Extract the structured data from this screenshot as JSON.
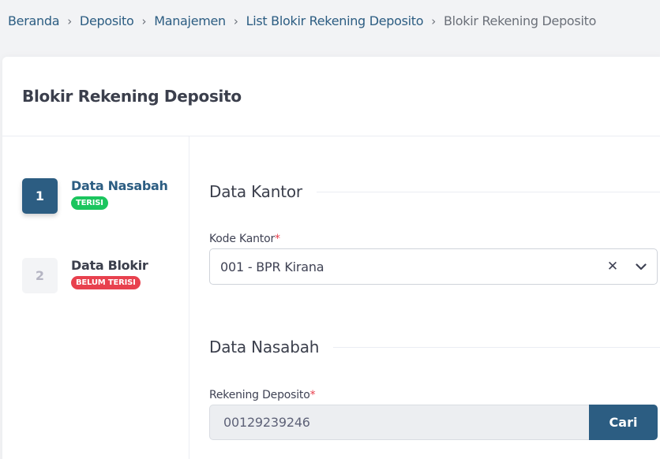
{
  "breadcrumb": {
    "items": [
      "Beranda",
      "Deposito",
      "Manajemen",
      "List Blokir Rekening Deposito"
    ],
    "current": "Blokir Rekening Deposito"
  },
  "card": {
    "title": "Blokir Rekening Deposito"
  },
  "wizard": {
    "steps": [
      {
        "number": "1",
        "title": "Data Nasabah",
        "status": "TERISI"
      },
      {
        "number": "2",
        "title": "Data Blokir",
        "status": "BELUM TERISI"
      }
    ]
  },
  "form": {
    "section_kantor": "Data Kantor",
    "kode_kantor_label": "Kode Kantor",
    "required_mark": "*",
    "kode_kantor_value": "001 - BPR Kirana",
    "section_nasabah": "Data Nasabah",
    "rekening_label": "Rekening Deposito",
    "rekening_value": "00129239246",
    "search_button": "Cari",
    "clear_symbol": "✕"
  },
  "colors": {
    "primary": "#2c5d82",
    "success": "#1bc55e",
    "danger": "#e8414e"
  }
}
